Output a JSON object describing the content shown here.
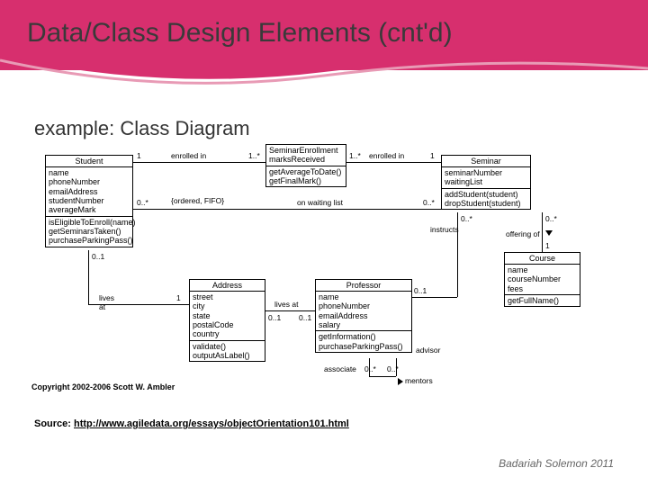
{
  "header": {
    "title": "Data/Class Design Elements (cnt'd)"
  },
  "subtitle": "example: Class Diagram",
  "classes": {
    "student": {
      "name": "Student",
      "attrs": [
        "name",
        "phoneNumber",
        "emailAddress",
        "studentNumber",
        "averageMark"
      ],
      "ops": [
        "isEligibleToEnroll(name)",
        "getSeminarsTaken()",
        "purchaseParkingPass()"
      ]
    },
    "enrollment": {
      "name": "Enrollment",
      "attrs": [
        "SeminarEnrollment",
        "marksReceived"
      ],
      "ops": [
        "getAverageToDate()",
        "getFinalMark()"
      ]
    },
    "seminar": {
      "name": "Seminar",
      "attrs": [
        "seminarNumber",
        "waitingList"
      ],
      "ops": [
        "addStudent(student)",
        "dropStudent(student)"
      ]
    },
    "address": {
      "name": "Address",
      "attrs": [
        "street",
        "city",
        "state",
        "postalCode",
        "country"
      ],
      "ops": [
        "validate()",
        "outputAsLabel()"
      ]
    },
    "professor": {
      "name": "Professor",
      "attrs": [
        "name",
        "phoneNumber",
        "emailAddress",
        "salary"
      ],
      "ops": [
        "getInformation()",
        "purchaseParkingPass()"
      ]
    },
    "course": {
      "name": "Course",
      "attrs": [
        "name",
        "courseNumber",
        "fees"
      ],
      "ops": [
        "getFullName()"
      ]
    }
  },
  "relationships": {
    "enrolledIn1": {
      "label": "enrolled in",
      "m1": "1",
      "m2": "1..*"
    },
    "enrolledIn2": {
      "label": "enrolled in",
      "m1": "1..*",
      "m2": "1"
    },
    "onWaitingList": {
      "label": "on waiting list",
      "note": "{ordered, FIFO}",
      "m1": "0..*",
      "m2": "0..*"
    },
    "livesAt": {
      "label": "lives at",
      "m1": "0..1",
      "m2": "1"
    },
    "livesAt2": {
      "label": "lives at",
      "m1": "0..1",
      "m2": "0..1"
    },
    "instructs": {
      "label": "instructs",
      "m1": "0..*",
      "m2": "0..1"
    },
    "offeringOf": {
      "label": "offering of",
      "m1": "0..*",
      "m2": "1"
    },
    "advisor": {
      "label": "advisor",
      "m1": "",
      "m2": ""
    },
    "associate": {
      "label": "associate",
      "m1": "0..*",
      "m2": ""
    },
    "mentors": {
      "label": "mentors",
      "m1": "0..*",
      "m2": ""
    }
  },
  "copyright": "Copyright 2002-2006 Scott W. Ambler",
  "source": {
    "label": "Source: ",
    "url": "http://www.agiledata.org/essays/objectOrientation101.html"
  },
  "footer": "Badariah Solemon 2011"
}
